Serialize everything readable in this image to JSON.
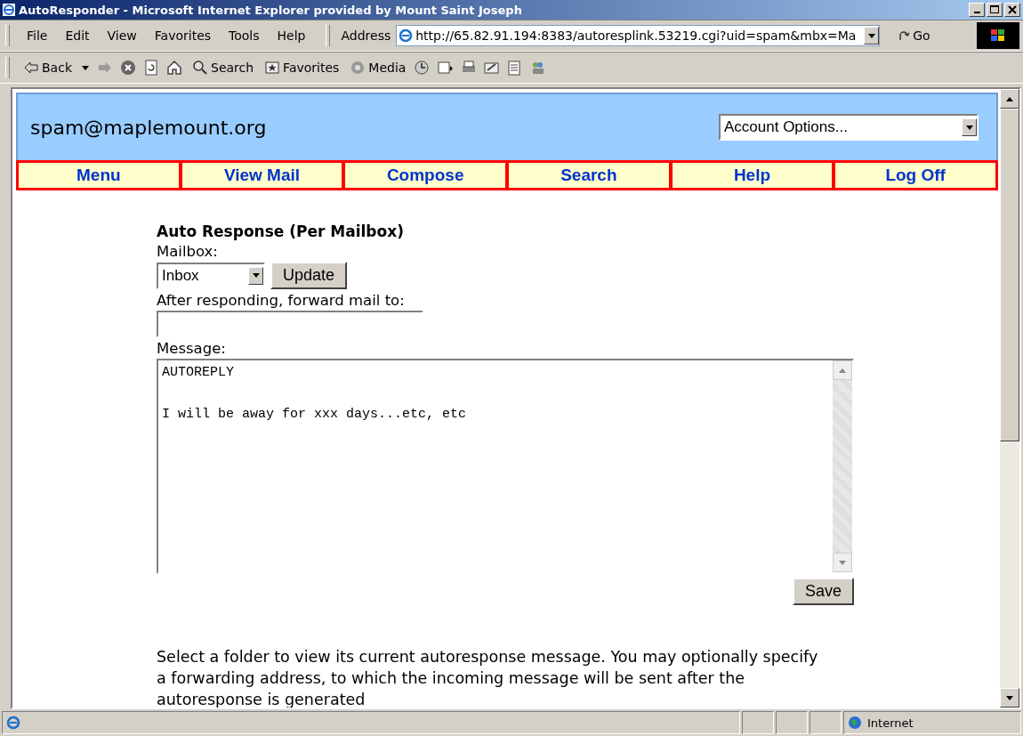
{
  "window": {
    "title": "AutoResponder - Microsoft Internet Explorer provided by Mount Saint Joseph"
  },
  "menu_bar": [
    "File",
    "Edit",
    "View",
    "Favorites",
    "Tools",
    "Help"
  ],
  "address_bar": {
    "label": "Address",
    "url": "http://65.82.91.194:8383/autoresplink.53219.cgi?uid=spam&mbx=Ma",
    "go": "Go"
  },
  "toolbar": [
    {
      "kind": "back",
      "label": "Back"
    },
    {
      "kind": "forward"
    },
    {
      "kind": "stop"
    },
    {
      "kind": "refresh"
    },
    {
      "kind": "home"
    },
    {
      "kind": "search",
      "label": "Search"
    },
    {
      "kind": "favorites",
      "label": "Favorites"
    },
    {
      "kind": "media",
      "label": "Media"
    },
    {
      "kind": "history"
    },
    {
      "kind": "mail"
    },
    {
      "kind": "print"
    },
    {
      "kind": "edit"
    },
    {
      "kind": "discuss"
    },
    {
      "kind": "messenger"
    }
  ],
  "page": {
    "account": "spam@maplemount.org",
    "account_select": "Account Options...",
    "nav": [
      "Menu",
      "View Mail",
      "Compose",
      "Search",
      "Help",
      "Log Off"
    ],
    "form": {
      "heading": "Auto Response (Per Mailbox)",
      "mailbox_label": "Mailbox:",
      "mailbox_value": "Inbox",
      "update_button": "Update",
      "forward_label": "After responding, forward mail to:",
      "message_label": "Message:",
      "message": "AUTOREPLY\n\nI will be away for xxx days...etc, etc",
      "save_button": "Save"
    },
    "help_text": "Select a folder to view its current autoresponse message. You may optionally specify a forwarding address, to which the incoming message will be sent after the autoresponse is generated"
  },
  "status_bar": {
    "zone": "Internet"
  }
}
